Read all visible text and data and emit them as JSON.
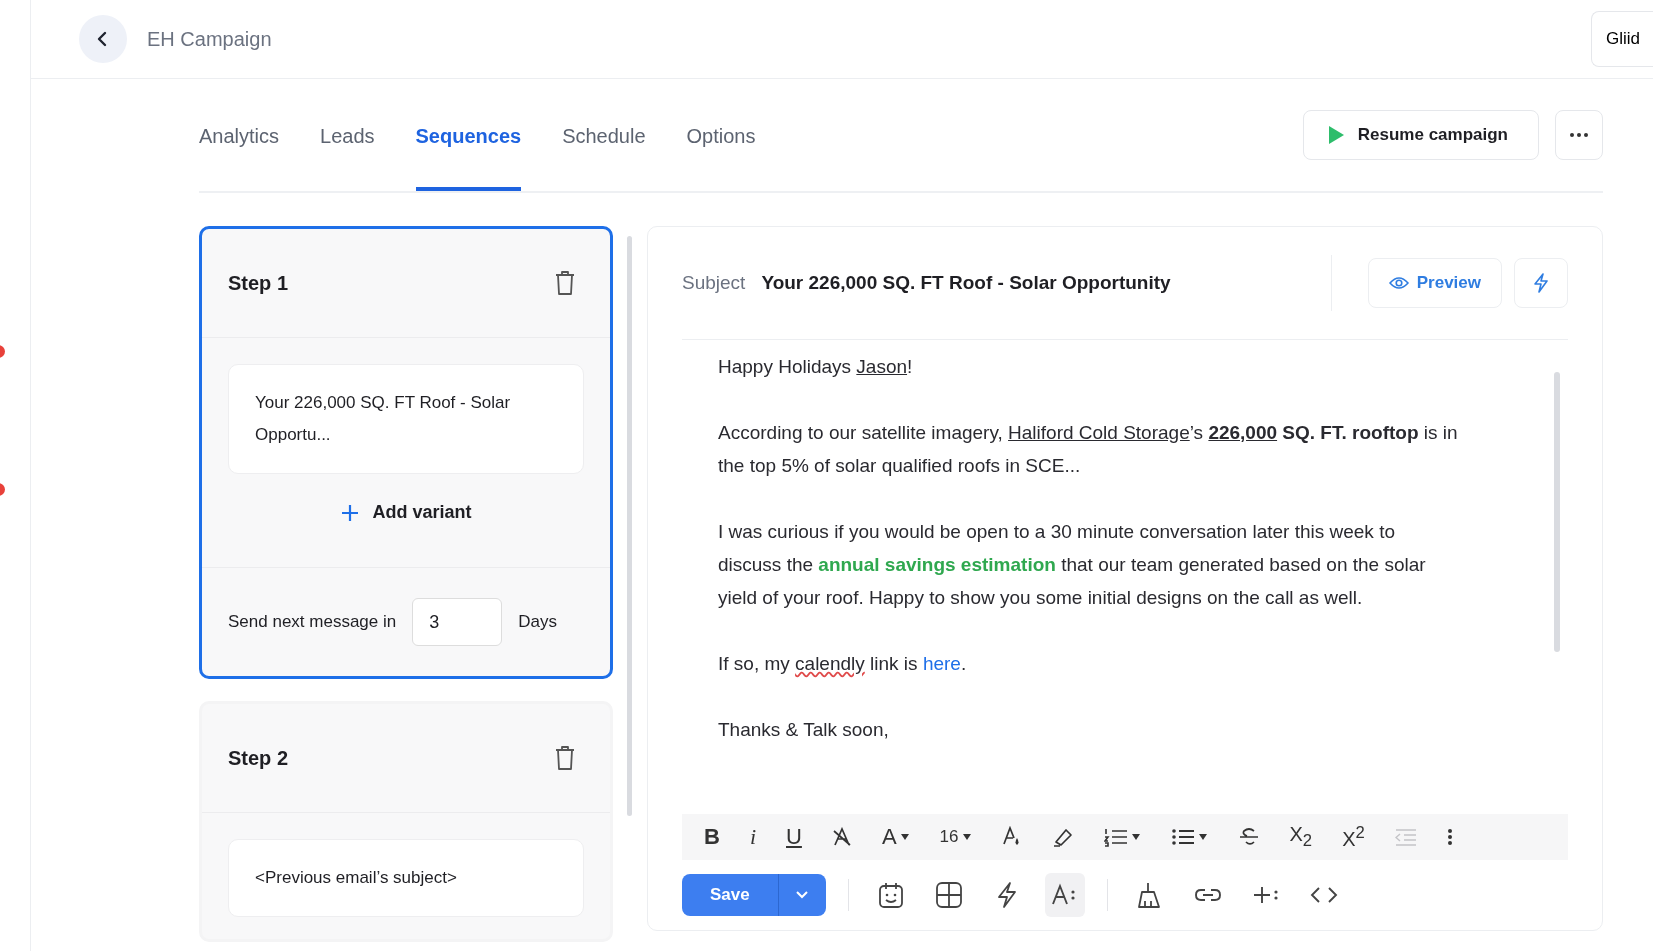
{
  "header": {
    "title": "EH Campaign",
    "corner_button": "Gliid"
  },
  "tabs": [
    {
      "label": "Analytics",
      "selected": false
    },
    {
      "label": "Leads",
      "selected": false
    },
    {
      "label": "Sequences",
      "selected": true
    },
    {
      "label": "Schedule",
      "selected": false
    },
    {
      "label": "Options",
      "selected": false
    }
  ],
  "resume_button": "Resume campaign",
  "steps": [
    {
      "title": "Step 1",
      "selected": true,
      "variants": [
        "Your 226,000 SQ. FT Roof - Solar Opportu..."
      ],
      "add_variant": "Add variant",
      "delay": {
        "label": "Send next message in",
        "value": "3",
        "unit": "Days"
      }
    },
    {
      "title": "Step 2",
      "selected": false,
      "variants": [
        "<Previous email’s subject>"
      ]
    }
  ],
  "editor": {
    "subject_label": "Subject",
    "subject": "Your 226,000 SQ. FT Roof - Solar Opportunity",
    "preview_button": "Preview",
    "paragraphs": [
      [
        {
          "kind": "text",
          "text": "Happy Holidays "
        },
        {
          "kind": "underline",
          "text": "Jason"
        },
        {
          "kind": "text",
          "text": "!"
        }
      ],
      [
        {
          "kind": "text",
          "text": "According to our satellite imagery, "
        },
        {
          "kind": "underline",
          "text": "Haliford Cold Storage"
        },
        {
          "kind": "text",
          "text": "’s "
        },
        {
          "kind": "bold_underline",
          "text": "226,000"
        },
        {
          "kind": "bold",
          "text": " SQ. FT. rooftop"
        },
        {
          "kind": "text",
          "text": " is in the top 5% of solar qualified roofs in SCE..."
        }
      ],
      [
        {
          "kind": "text",
          "text": "I was curious if you would be open to a 30 minute conversation later this week to discuss the "
        },
        {
          "kind": "green",
          "text": "annual savings estimation"
        },
        {
          "kind": "text",
          "text": " that our team generated based on the solar yield of your roof. Happy to show you some initial designs on the call as well."
        }
      ],
      [
        {
          "kind": "text",
          "text": "If so, my "
        },
        {
          "kind": "misspelled",
          "text": "calendly"
        },
        {
          "kind": "text",
          "text": " link is "
        },
        {
          "kind": "link",
          "text": "here"
        },
        {
          "kind": "text",
          "text": "."
        }
      ],
      [
        {
          "kind": "text",
          "text": "Thanks & Talk soon,"
        }
      ]
    ],
    "toolbar": [
      {
        "kind": "bold",
        "label": "B",
        "caret": false,
        "disabled": false
      },
      {
        "kind": "italic",
        "label": "i",
        "caret": false,
        "disabled": false
      },
      {
        "kind": "underline",
        "label": "U",
        "caret": false,
        "disabled": false
      },
      {
        "kind": "clear",
        "caret": false,
        "disabled": false
      },
      {
        "kind": "font_color",
        "label": "A",
        "caret": true,
        "disabled": false
      },
      {
        "kind": "font_size",
        "label": "16",
        "caret": true,
        "disabled": false
      },
      {
        "kind": "fill_color",
        "caret": false,
        "disabled": false
      },
      {
        "kind": "highlight",
        "caret": false,
        "disabled": false
      },
      {
        "kind": "ordered_list",
        "caret": true,
        "disabled": false
      },
      {
        "kind": "bullet_list",
        "caret": true,
        "disabled": false
      },
      {
        "kind": "strike",
        "caret": false,
        "disabled": false
      },
      {
        "kind": "subscript",
        "label": "X$_{2}$",
        "caret": false,
        "disabled": false
      },
      {
        "kind": "superscript",
        "label": "X$^{2}$",
        "caret": false,
        "disabled": false
      },
      {
        "kind": "indent",
        "caret": false,
        "disabled": true
      },
      {
        "kind": "more",
        "caret": false,
        "disabled": false
      }
    ],
    "save_button": "Save",
    "action_groups": [
      [
        {
          "kind": "calendar",
          "selected": false
        },
        {
          "kind": "table",
          "selected": false
        },
        {
          "kind": "bolt",
          "selected": false
        },
        {
          "kind": "variables",
          "selected": true
        }
      ],
      [
        {
          "kind": "broom",
          "selected": false
        },
        {
          "kind": "link",
          "selected": false
        },
        {
          "kind": "insert",
          "selected": false
        },
        {
          "kind": "code",
          "selected": false
        }
      ]
    ]
  }
}
